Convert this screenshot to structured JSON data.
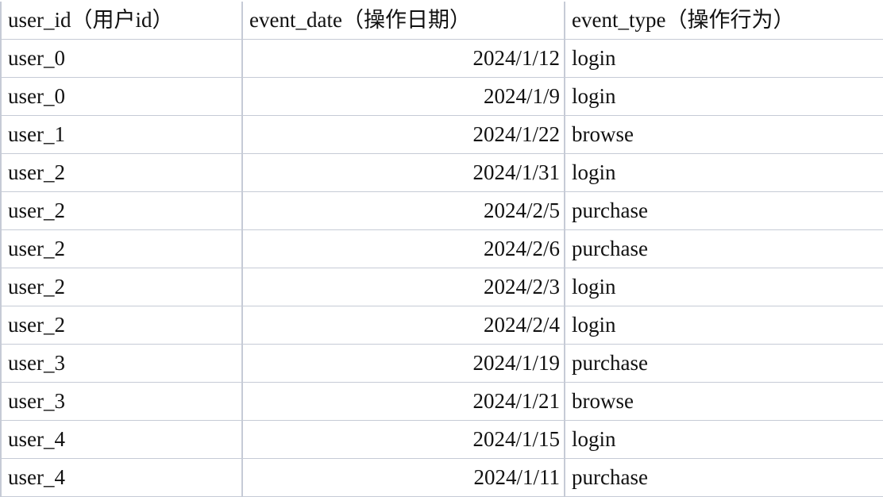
{
  "table": {
    "headers": [
      "user_id（用户id）",
      "event_date（操作日期）",
      "event_type（操作行为）"
    ],
    "rows": [
      [
        "user_0",
        "2024/1/12",
        "login"
      ],
      [
        "user_0",
        "2024/1/9",
        "login"
      ],
      [
        "user_1",
        "2024/1/22",
        "browse"
      ],
      [
        "user_2",
        "2024/1/31",
        "login"
      ],
      [
        "user_2",
        "2024/2/5",
        "purchase"
      ],
      [
        "user_2",
        "2024/2/6",
        "purchase"
      ],
      [
        "user_2",
        "2024/2/3",
        "login"
      ],
      [
        "user_2",
        "2024/2/4",
        "login"
      ],
      [
        "user_3",
        "2024/1/19",
        "purchase"
      ],
      [
        "user_3",
        "2024/1/21",
        "browse"
      ],
      [
        "user_4",
        "2024/1/15",
        "login"
      ],
      [
        "user_4",
        "2024/1/11",
        "purchase"
      ]
    ]
  },
  "colors": {
    "gridline": "#c6cbd6",
    "text": "#111111",
    "background": "#ffffff"
  }
}
